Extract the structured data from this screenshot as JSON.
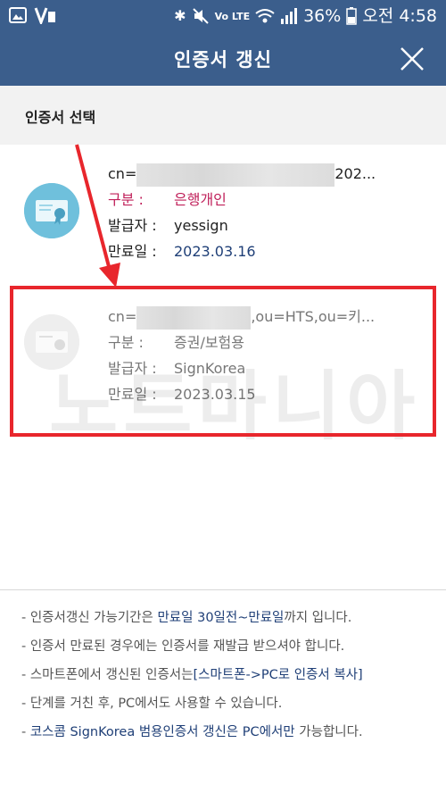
{
  "status_bar": {
    "left_icons": [
      "gallery-icon",
      "v-icon"
    ],
    "bluetooth": "✱",
    "network_label": "Vo LTE",
    "battery_percent": "36%",
    "time": "오전 4:58"
  },
  "header": {
    "title": "인증서 갱신",
    "close_label": "×"
  },
  "section": {
    "title": "인증서 선택"
  },
  "certificates": [
    {
      "cn_prefix": "cn=",
      "cn_suffix": "202...",
      "type_label": "구분 :",
      "type_value": "은행개인",
      "issuer_label": "발급자 :",
      "issuer_value": "yessign",
      "expiry_label": "만료일 :",
      "expiry_value": "2023.03.16",
      "icon": "certificate-icon",
      "icon_color": "#6fc0dc"
    },
    {
      "cn_prefix": "cn=",
      "cn_suffix": ",ou=HTS,ou=키...",
      "type_label": "구분 :",
      "type_value": "증권/보험용",
      "issuer_label": "발급자 :",
      "issuer_value": "SignKorea",
      "expiry_label": "만료일 :",
      "expiry_value": "2023.03.15",
      "icon": "certificate-icon",
      "icon_color": "#eeeeee"
    }
  ],
  "watermark": "노트마니아",
  "colors": {
    "header_bg": "#3b5e8c",
    "highlight": "#e8262c",
    "type_text": "#c0205a",
    "link_text": "#1f3f77"
  },
  "notes": [
    {
      "a": "- 인증서갱신 가능기간은 ",
      "b": "만료일 30일전~만료일",
      "c": "까지 입니다."
    },
    {
      "a": "- 인증서 만료된 경우에는 인증서를 재발급 받으셔야 합니다.",
      "b": "",
      "c": ""
    },
    {
      "a": "- 스마트폰에서 갱신된 인증서는",
      "b": "[스마트폰->PC로 인증서 복사]",
      "c": ""
    },
    {
      "a": "- 단계를 거친 후, PC에서도 사용할 수 있습니다.",
      "b": "",
      "c": ""
    },
    {
      "a": "- ",
      "b": "코스콤 SignKorea 범용인증서 갱신은 PC에서만",
      "c": " 가능합니다."
    }
  ]
}
